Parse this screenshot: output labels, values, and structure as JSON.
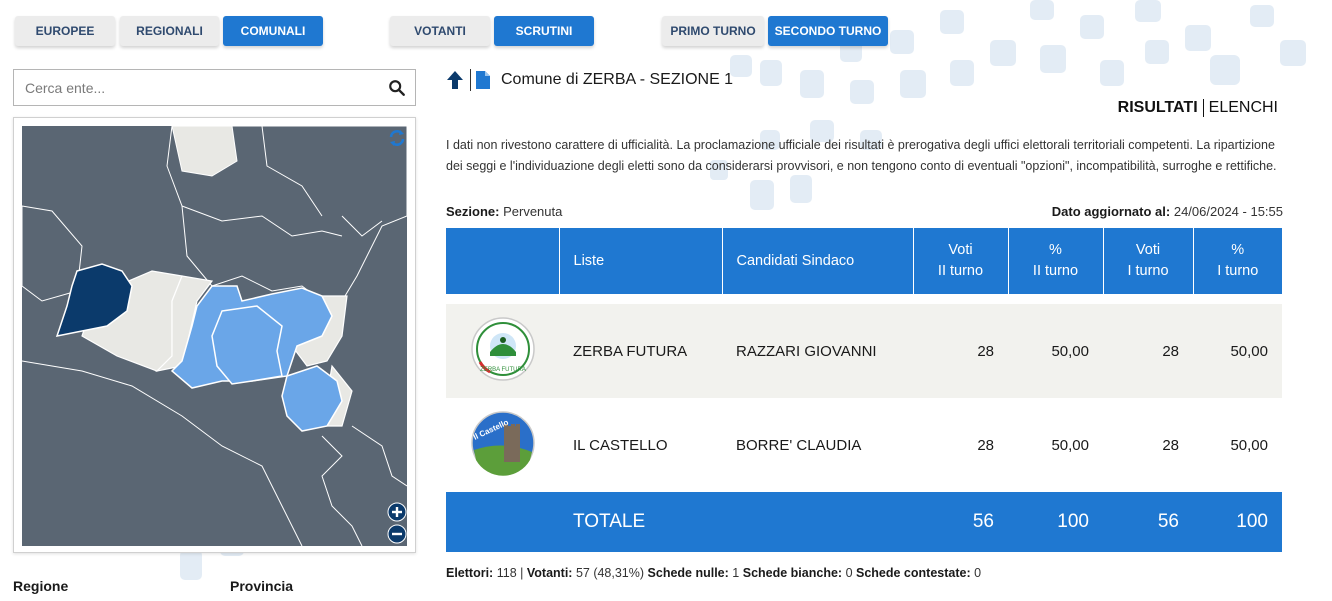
{
  "nav": {
    "europee": "EUROPEE",
    "regionali": "REGIONALI",
    "comunali": "COMUNALI",
    "votanti": "VOTANTI",
    "scrutini": "SCRUTINI",
    "primo_turno": "PRIMO TURNO",
    "secondo_turno": "SECONDO TURNO"
  },
  "search": {
    "placeholder": "Cerca ente..."
  },
  "map_labels": {
    "regione": "Regione",
    "provincia": "Provincia"
  },
  "header": {
    "title": "Comune di ZERBA - SEZIONE 1"
  },
  "views": {
    "risultati": "RISULTATI",
    "elenchi": "ELENCHI"
  },
  "disclaimer": "I dati non rivestono carattere di ufficialità. La proclamazione ufficiale dei risultati è prerogativa degli uffici elettorali territoriali competenti. La ripartizione dei seggi e l'individuazione degli eletti sono da considerarsi provvisori, e non tengono conto di eventuali \"opzioni\", incompatibilità, surroghe e rettifiche.",
  "sezione": {
    "label": "Sezione:",
    "value": "Pervenuta"
  },
  "aggiornato": {
    "label": "Dato aggiornato al:",
    "value": "24/06/2024 - 15:55"
  },
  "table": {
    "headers": {
      "liste": "Liste",
      "candidati": "Candidati Sindaco",
      "voti_ii_a": "Voti",
      "voti_ii_b": "II turno",
      "perc_ii_a": "%",
      "perc_ii_b": "II turno",
      "voti_i_a": "Voti",
      "voti_i_b": "I turno",
      "perc_i_a": "%",
      "perc_i_b": "I turno"
    },
    "rows": [
      {
        "lista": "ZERBA FUTURA",
        "candidato": "RAZZARI GIOVANNI",
        "voti_ii": "28",
        "perc_ii": "50,00",
        "voti_i": "28",
        "perc_i": "50,00",
        "logo_text": "ZERBA FUTURA"
      },
      {
        "lista": "IL CASTELLO",
        "candidato": "BORRE' CLAUDIA",
        "voti_ii": "28",
        "perc_ii": "50,00",
        "voti_i": "28",
        "perc_i": "50,00",
        "logo_text": "Il Castello"
      }
    ],
    "total": {
      "label": "TOTALE",
      "voti_ii": "56",
      "perc_ii": "100",
      "voti_i": "56",
      "perc_i": "100"
    }
  },
  "stats": {
    "elettori_label": "Elettori:",
    "elettori": "118",
    "votanti_label": "Votanti:",
    "votanti": "57 (48,31%)",
    "nulle_label": "Schede nulle:",
    "nulle": "1",
    "bianche_label": "Schede bianche:",
    "bianche": "0",
    "contestate_label": "Schede contestate:",
    "contestate": "0"
  },
  "colors": {
    "accent": "#1f78d1",
    "map_dark": "#5a6673",
    "map_light": "#e8e8e4",
    "map_highlight": "#6aa6e8",
    "map_selected": "#0b3a6b"
  }
}
